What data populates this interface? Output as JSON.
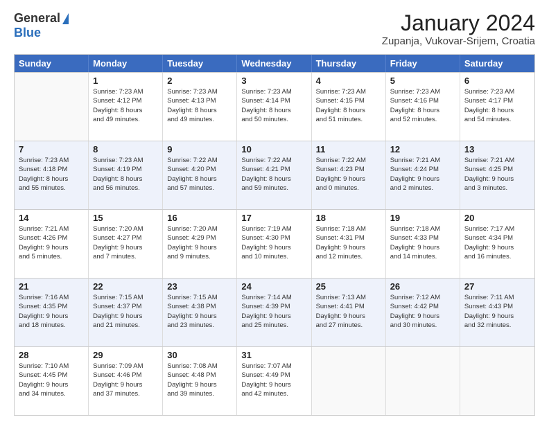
{
  "header": {
    "logo_general": "General",
    "logo_blue": "Blue",
    "month_title": "January 2024",
    "location": "Zupanja, Vukovar-Srijem, Croatia"
  },
  "calendar": {
    "days_of_week": [
      "Sunday",
      "Monday",
      "Tuesday",
      "Wednesday",
      "Thursday",
      "Friday",
      "Saturday"
    ],
    "rows": [
      [
        {
          "day": "",
          "info": ""
        },
        {
          "day": "1",
          "info": "Sunrise: 7:23 AM\nSunset: 4:12 PM\nDaylight: 8 hours\nand 49 minutes."
        },
        {
          "day": "2",
          "info": "Sunrise: 7:23 AM\nSunset: 4:13 PM\nDaylight: 8 hours\nand 49 minutes."
        },
        {
          "day": "3",
          "info": "Sunrise: 7:23 AM\nSunset: 4:14 PM\nDaylight: 8 hours\nand 50 minutes."
        },
        {
          "day": "4",
          "info": "Sunrise: 7:23 AM\nSunset: 4:15 PM\nDaylight: 8 hours\nand 51 minutes."
        },
        {
          "day": "5",
          "info": "Sunrise: 7:23 AM\nSunset: 4:16 PM\nDaylight: 8 hours\nand 52 minutes."
        },
        {
          "day": "6",
          "info": "Sunrise: 7:23 AM\nSunset: 4:17 PM\nDaylight: 8 hours\nand 54 minutes."
        }
      ],
      [
        {
          "day": "7",
          "info": "Sunrise: 7:23 AM\nSunset: 4:18 PM\nDaylight: 8 hours\nand 55 minutes."
        },
        {
          "day": "8",
          "info": "Sunrise: 7:23 AM\nSunset: 4:19 PM\nDaylight: 8 hours\nand 56 minutes."
        },
        {
          "day": "9",
          "info": "Sunrise: 7:22 AM\nSunset: 4:20 PM\nDaylight: 8 hours\nand 57 minutes."
        },
        {
          "day": "10",
          "info": "Sunrise: 7:22 AM\nSunset: 4:21 PM\nDaylight: 8 hours\nand 59 minutes."
        },
        {
          "day": "11",
          "info": "Sunrise: 7:22 AM\nSunset: 4:23 PM\nDaylight: 9 hours\nand 0 minutes."
        },
        {
          "day": "12",
          "info": "Sunrise: 7:21 AM\nSunset: 4:24 PM\nDaylight: 9 hours\nand 2 minutes."
        },
        {
          "day": "13",
          "info": "Sunrise: 7:21 AM\nSunset: 4:25 PM\nDaylight: 9 hours\nand 3 minutes."
        }
      ],
      [
        {
          "day": "14",
          "info": "Sunrise: 7:21 AM\nSunset: 4:26 PM\nDaylight: 9 hours\nand 5 minutes."
        },
        {
          "day": "15",
          "info": "Sunrise: 7:20 AM\nSunset: 4:27 PM\nDaylight: 9 hours\nand 7 minutes."
        },
        {
          "day": "16",
          "info": "Sunrise: 7:20 AM\nSunset: 4:29 PM\nDaylight: 9 hours\nand 9 minutes."
        },
        {
          "day": "17",
          "info": "Sunrise: 7:19 AM\nSunset: 4:30 PM\nDaylight: 9 hours\nand 10 minutes."
        },
        {
          "day": "18",
          "info": "Sunrise: 7:18 AM\nSunset: 4:31 PM\nDaylight: 9 hours\nand 12 minutes."
        },
        {
          "day": "19",
          "info": "Sunrise: 7:18 AM\nSunset: 4:33 PM\nDaylight: 9 hours\nand 14 minutes."
        },
        {
          "day": "20",
          "info": "Sunrise: 7:17 AM\nSunset: 4:34 PM\nDaylight: 9 hours\nand 16 minutes."
        }
      ],
      [
        {
          "day": "21",
          "info": "Sunrise: 7:16 AM\nSunset: 4:35 PM\nDaylight: 9 hours\nand 18 minutes."
        },
        {
          "day": "22",
          "info": "Sunrise: 7:15 AM\nSunset: 4:37 PM\nDaylight: 9 hours\nand 21 minutes."
        },
        {
          "day": "23",
          "info": "Sunrise: 7:15 AM\nSunset: 4:38 PM\nDaylight: 9 hours\nand 23 minutes."
        },
        {
          "day": "24",
          "info": "Sunrise: 7:14 AM\nSunset: 4:39 PM\nDaylight: 9 hours\nand 25 minutes."
        },
        {
          "day": "25",
          "info": "Sunrise: 7:13 AM\nSunset: 4:41 PM\nDaylight: 9 hours\nand 27 minutes."
        },
        {
          "day": "26",
          "info": "Sunrise: 7:12 AM\nSunset: 4:42 PM\nDaylight: 9 hours\nand 30 minutes."
        },
        {
          "day": "27",
          "info": "Sunrise: 7:11 AM\nSunset: 4:43 PM\nDaylight: 9 hours\nand 32 minutes."
        }
      ],
      [
        {
          "day": "28",
          "info": "Sunrise: 7:10 AM\nSunset: 4:45 PM\nDaylight: 9 hours\nand 34 minutes."
        },
        {
          "day": "29",
          "info": "Sunrise: 7:09 AM\nSunset: 4:46 PM\nDaylight: 9 hours\nand 37 minutes."
        },
        {
          "day": "30",
          "info": "Sunrise: 7:08 AM\nSunset: 4:48 PM\nDaylight: 9 hours\nand 39 minutes."
        },
        {
          "day": "31",
          "info": "Sunrise: 7:07 AM\nSunset: 4:49 PM\nDaylight: 9 hours\nand 42 minutes."
        },
        {
          "day": "",
          "info": ""
        },
        {
          "day": "",
          "info": ""
        },
        {
          "day": "",
          "info": ""
        }
      ]
    ]
  }
}
